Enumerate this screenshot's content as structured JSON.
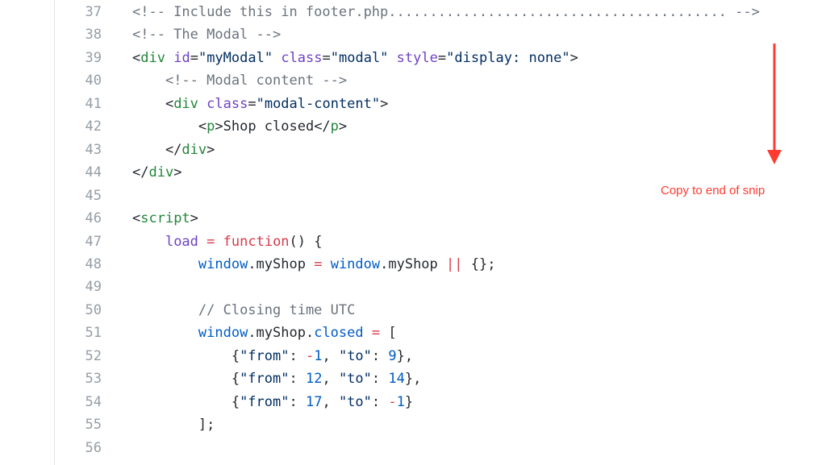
{
  "annotation": {
    "text": "Copy to end of snip",
    "color": "#ff3b30"
  },
  "colors": {
    "comment": "#6a737d",
    "tag": "#22863a",
    "attribute": "#6f42c1",
    "string": "#032f62",
    "keyword": "#d73a49",
    "object": "#005cc5",
    "plain": "#24292e",
    "line_number": "#959da5"
  },
  "lines": [
    {
      "n": "37",
      "tokens": [
        [
          "com",
          "<!-- Include this in footer.php......................................... -->"
        ]
      ]
    },
    {
      "n": "38",
      "tokens": [
        [
          "com",
          "<!-- The Modal -->"
        ]
      ]
    },
    {
      "n": "39",
      "tokens": [
        [
          "pl",
          "<"
        ],
        [
          "tag",
          "div"
        ],
        [
          "pl",
          " "
        ],
        [
          "attr",
          "id"
        ],
        [
          "pl",
          "="
        ],
        [
          "str",
          "\"myModal\""
        ],
        [
          "pl",
          " "
        ],
        [
          "attr",
          "class"
        ],
        [
          "pl",
          "="
        ],
        [
          "str",
          "\"modal\""
        ],
        [
          "pl",
          " "
        ],
        [
          "attr",
          "style"
        ],
        [
          "pl",
          "="
        ],
        [
          "str",
          "\"display: none\""
        ],
        [
          "pl",
          ">"
        ]
      ]
    },
    {
      "n": "40",
      "tokens": [
        [
          "pl",
          "    "
        ],
        [
          "com",
          "<!-- Modal content -->"
        ]
      ]
    },
    {
      "n": "41",
      "tokens": [
        [
          "pl",
          "    <"
        ],
        [
          "tag",
          "div"
        ],
        [
          "pl",
          " "
        ],
        [
          "attr",
          "class"
        ],
        [
          "pl",
          "="
        ],
        [
          "str",
          "\"modal-content\""
        ],
        [
          "pl",
          ">"
        ]
      ]
    },
    {
      "n": "42",
      "tokens": [
        [
          "pl",
          "        <"
        ],
        [
          "tag",
          "p"
        ],
        [
          "pl",
          ">Shop closed</"
        ],
        [
          "tag",
          "p"
        ],
        [
          "pl",
          ">"
        ]
      ]
    },
    {
      "n": "43",
      "tokens": [
        [
          "pl",
          "    </"
        ],
        [
          "tag",
          "div"
        ],
        [
          "pl",
          ">"
        ]
      ]
    },
    {
      "n": "44",
      "tokens": [
        [
          "pl",
          "</"
        ],
        [
          "tag",
          "div"
        ],
        [
          "pl",
          ">"
        ]
      ]
    },
    {
      "n": "45",
      "tokens": []
    },
    {
      "n": "46",
      "tokens": [
        [
          "pl",
          "<"
        ],
        [
          "tag",
          "script"
        ],
        [
          "pl",
          ">"
        ]
      ]
    },
    {
      "n": "47",
      "tokens": [
        [
          "pl",
          "    "
        ],
        [
          "fn",
          "load"
        ],
        [
          "pl",
          " "
        ],
        [
          "key",
          "="
        ],
        [
          "pl",
          " "
        ],
        [
          "key",
          "function"
        ],
        [
          "pl",
          "() {"
        ]
      ]
    },
    {
      "n": "48",
      "tokens": [
        [
          "pl",
          "        "
        ],
        [
          "obj",
          "window"
        ],
        [
          "pl",
          ".myShop "
        ],
        [
          "key",
          "="
        ],
        [
          "pl",
          " "
        ],
        [
          "obj",
          "window"
        ],
        [
          "pl",
          ".myShop "
        ],
        [
          "key",
          "||"
        ],
        [
          "pl",
          " {};"
        ]
      ]
    },
    {
      "n": "49",
      "tokens": []
    },
    {
      "n": "50",
      "tokens": [
        [
          "pl",
          "        "
        ],
        [
          "com",
          "// Closing time UTC"
        ]
      ]
    },
    {
      "n": "51",
      "tokens": [
        [
          "pl",
          "        "
        ],
        [
          "obj",
          "window"
        ],
        [
          "pl",
          ".myShop."
        ],
        [
          "obj",
          "closed"
        ],
        [
          "pl",
          " "
        ],
        [
          "key",
          "="
        ],
        [
          "pl",
          " ["
        ]
      ]
    },
    {
      "n": "52",
      "tokens": [
        [
          "pl",
          "            {"
        ],
        [
          "str",
          "\"from\""
        ],
        [
          "pl",
          ": "
        ],
        [
          "key",
          "-"
        ],
        [
          "num",
          "1"
        ],
        [
          "pl",
          ", "
        ],
        [
          "str",
          "\"to\""
        ],
        [
          "pl",
          ": "
        ],
        [
          "num",
          "9"
        ],
        [
          "pl",
          "},"
        ]
      ]
    },
    {
      "n": "53",
      "tokens": [
        [
          "pl",
          "            {"
        ],
        [
          "str",
          "\"from\""
        ],
        [
          "pl",
          ": "
        ],
        [
          "num",
          "12"
        ],
        [
          "pl",
          ", "
        ],
        [
          "str",
          "\"to\""
        ],
        [
          "pl",
          ": "
        ],
        [
          "num",
          "14"
        ],
        [
          "pl",
          "},"
        ]
      ]
    },
    {
      "n": "54",
      "tokens": [
        [
          "pl",
          "            {"
        ],
        [
          "str",
          "\"from\""
        ],
        [
          "pl",
          ": "
        ],
        [
          "num",
          "17"
        ],
        [
          "pl",
          ", "
        ],
        [
          "str",
          "\"to\""
        ],
        [
          "pl",
          ": "
        ],
        [
          "key",
          "-"
        ],
        [
          "num",
          "1"
        ],
        [
          "pl",
          "}"
        ]
      ]
    },
    {
      "n": "55",
      "tokens": [
        [
          "pl",
          "        ];"
        ]
      ]
    },
    {
      "n": "56",
      "tokens": []
    }
  ]
}
